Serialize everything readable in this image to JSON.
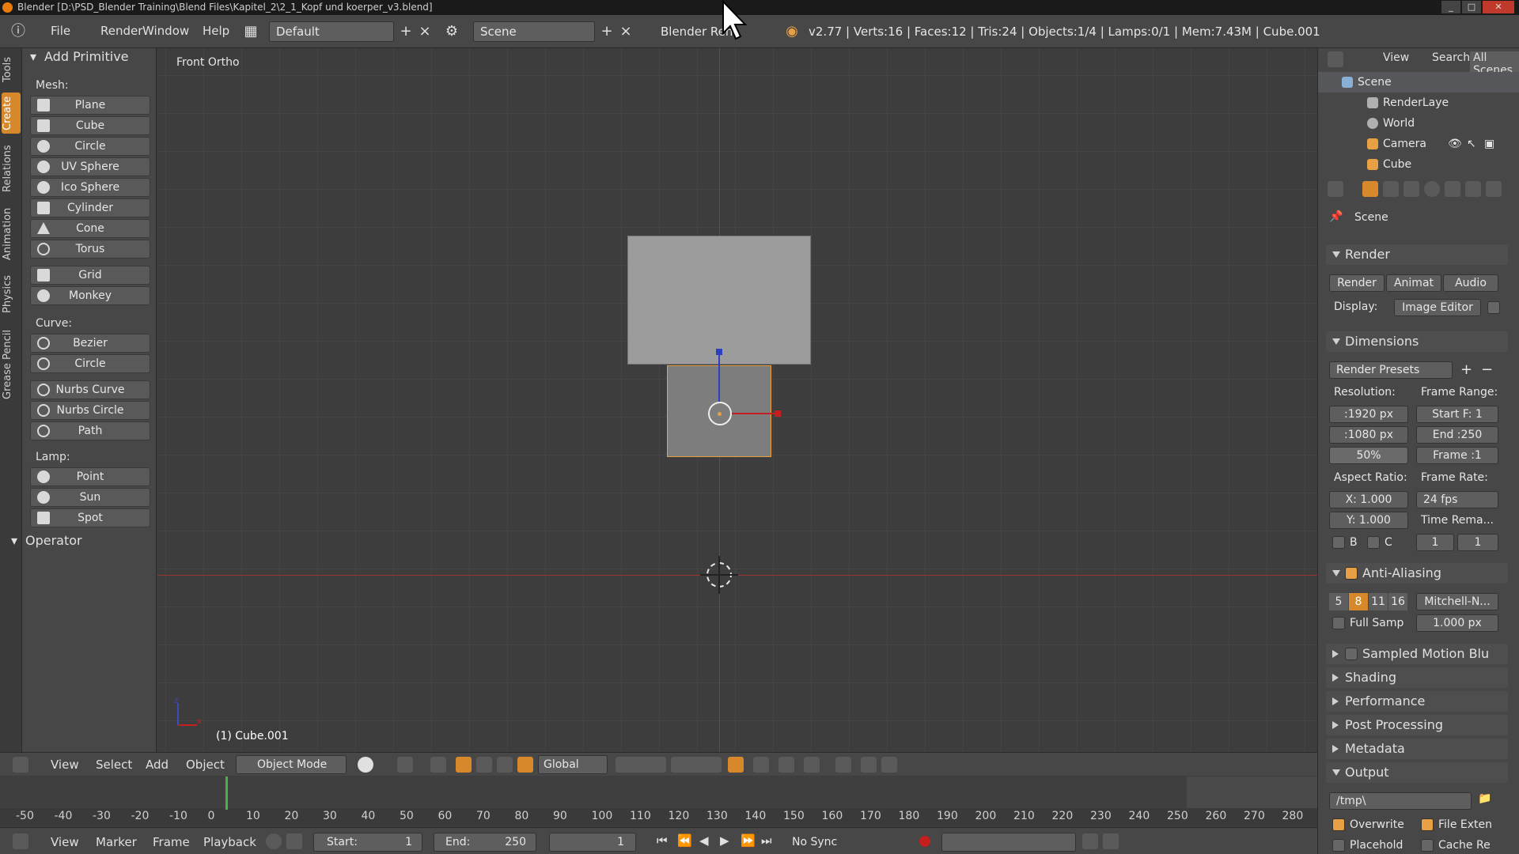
{
  "window": {
    "title": "Blender [D:\\PSD_Blender Training\\Blend Files\\Kapitel_2\\2_1_Kopf und koerper_v3.blend]"
  },
  "info_header": {
    "menus": [
      "File",
      "Render",
      "Window",
      "Help"
    ],
    "screen_layout": "Default",
    "scene": "Scene",
    "engine": "Blender Ren",
    "stats": "v2.77 | Verts:16 | Faces:12 | Tris:24 | Objects:1/4 | Lamps:0/1 | Mem:7.43M | Cube.001"
  },
  "tool_tabs": [
    "Tools",
    "Create",
    "Relations",
    "Animation",
    "Physics",
    "Grease Pencil"
  ],
  "toolshelf": {
    "panel_title": "Add Primitive",
    "mesh_label": "Mesh:",
    "mesh_items": [
      "Plane",
      "Cube",
      "Circle",
      "UV Sphere",
      "Ico Sphere",
      "Cylinder",
      "Cone",
      "Torus"
    ],
    "mesh_items2": [
      "Grid",
      "Monkey"
    ],
    "curve_label": "Curve:",
    "curve_items": [
      "Bezier",
      "Circle"
    ],
    "curve_items2": [
      "Nurbs Curve",
      "Nurbs Circle",
      "Path"
    ],
    "lamp_label": "Lamp:",
    "lamp_items": [
      "Point",
      "Sun",
      "Spot"
    ],
    "operator_title": "Operator"
  },
  "viewport": {
    "view_name": "Front Ortho",
    "active_object": "(1) Cube.001"
  },
  "view3d_header": {
    "menus": [
      "View",
      "Select",
      "Add",
      "Object"
    ],
    "mode": "Object Mode",
    "orientation": "Global"
  },
  "timeline": {
    "ticks": [
      "-50",
      "-40",
      "-30",
      "-20",
      "-10",
      "0",
      "10",
      "20",
      "30",
      "40",
      "50",
      "60",
      "70",
      "80",
      "90",
      "100",
      "110",
      "120",
      "130",
      "140",
      "150",
      "160",
      "170",
      "180",
      "190",
      "200",
      "210",
      "220",
      "230",
      "240",
      "250",
      "260",
      "270",
      "280"
    ],
    "menus": [
      "View",
      "Marker",
      "Frame",
      "Playback"
    ],
    "start_label": "Start:",
    "start_value": "1",
    "end_label": "End:",
    "end_value": "250",
    "current_frame": "1",
    "sync": "No Sync"
  },
  "outliner": {
    "tabs": [
      "View",
      "Search",
      "All Scenes"
    ],
    "rows": [
      "Scene",
      "RenderLaye",
      "World",
      "Camera",
      "Cube"
    ]
  },
  "properties": {
    "context": "Scene",
    "render_title": "Render",
    "render_buttons": [
      "Render",
      "Animat",
      "Audio"
    ],
    "display_label": "Display:",
    "display_value": "Image Editor",
    "dimensions_title": "Dimensions",
    "render_presets": "Render Presets",
    "resolution_label": "Resolution:",
    "frame_range_label": "Frame Range:",
    "res_x": ":1920 px",
    "res_y": ":1080 px",
    "res_pct": "50%",
    "start_frame": "Start F: 1",
    "end_frame": "End :250",
    "frame_step": "Frame :1",
    "aspect_label": "Aspect Ratio:",
    "frame_rate_label": "Frame Rate:",
    "aspect_x": "X:  1.000",
    "aspect_y": "Y:  1.000",
    "fps": "24 fps",
    "time_remap": "Time Rema...",
    "b_label": "B",
    "c_label": "C",
    "remap_old": "1",
    "remap_new": "1",
    "aa_title": "Anti-Aliasing",
    "aa_samples": [
      "5",
      "8",
      "11",
      "16"
    ],
    "aa_filter": "Mitchell-N...",
    "full_sample": "Full Samp",
    "filter_size": "1.000 px",
    "motion_blur": "Sampled Motion Blu",
    "collapsed": [
      "Shading",
      "Performance",
      "Post Processing",
      "Metadata"
    ],
    "output_title": "Output",
    "output_path": "/tmp\\",
    "overwrite": "Overwrite",
    "file_ext": "File Exten",
    "placeholders": "Placehold",
    "cache": "Cache Re"
  },
  "colors": {
    "accent": "#d6882a",
    "x_axis": "#c41e1e",
    "z_axis": "#2f3fc2"
  }
}
